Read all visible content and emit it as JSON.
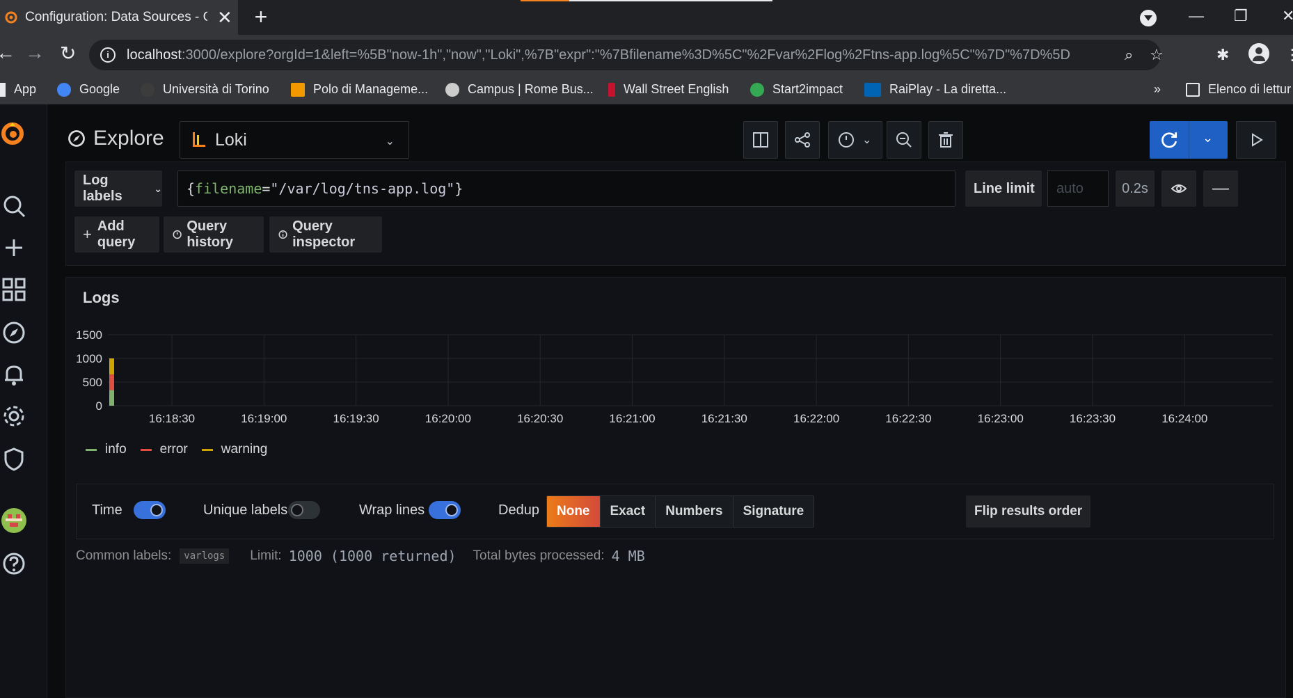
{
  "browser": {
    "tab_title": "Configuration: Data Sources - Gr",
    "tab_close": "✕",
    "new_tab": "+",
    "url_host": "localhost",
    "url_rest": ":3000/explore?orgId=1&left=%5B\"now-1h\",\"now\",\"Loki\",%7B\"expr\":\"%7Bfilename%3D%5C\"%2Fvar%2Flog%2Ftns-app.log%5C\"%7D\"%7D%5D",
    "bookmarks": [
      {
        "label": "App",
        "color": "#e8eaed"
      },
      {
        "label": "Google",
        "color": "#4285f4"
      },
      {
        "label": "Università di Torino",
        "color": "#3c3c3c"
      },
      {
        "label": "Polo di Manageme...",
        "color": "#f29900"
      },
      {
        "label": "Campus | Rome Bus...",
        "color": "#cccccc"
      },
      {
        "label": "Wall Street English",
        "color": "#c4122f"
      },
      {
        "label": "Start2impact",
        "color": "#34a853"
      },
      {
        "label": "RaiPlay - La diretta...",
        "color": "#0064b4"
      }
    ],
    "bookmarks_more": "»",
    "reading_list": "Elenco di lettur"
  },
  "explore": {
    "title": "Explore",
    "datasource": "Loki",
    "query_type": "Log labels",
    "query_parts": {
      "open": "{",
      "key": "filename",
      "eq": "=",
      "value": "\"/var/log/tns-app.log\"",
      "close": "}"
    },
    "line_limit_label": "Line limit",
    "line_limit_placeholder": "auto",
    "query_time": "0.2s",
    "add_query": "Add query",
    "query_history": "Query history",
    "query_inspector": "Query inspector"
  },
  "logs": {
    "title": "Logs",
    "options": {
      "time": {
        "label": "Time",
        "on": true
      },
      "unique_labels": {
        "label": "Unique labels",
        "on": false
      },
      "wrap_lines": {
        "label": "Wrap lines",
        "on": true
      }
    },
    "dedup_label": "Dedup",
    "dedup_options": [
      "None",
      "Exact",
      "Numbers",
      "Signature"
    ],
    "dedup_selected": "None",
    "flip_order": "Flip results order",
    "common_labels_label": "Common labels:",
    "common_label_value": "varlogs",
    "limit_label": "Limit:",
    "limit_value": "1000 (1000 returned)",
    "bytes_label": "Total bytes processed:",
    "bytes_value": "4 MB"
  },
  "chart_data": {
    "type": "bar",
    "title": "",
    "y_ticks": [
      "1500",
      "1000",
      "500",
      "0"
    ],
    "ylim": [
      0,
      1500
    ],
    "x_ticks": [
      "16:18:30",
      "16:19:00",
      "16:19:30",
      "16:20:00",
      "16:20:30",
      "16:21:00",
      "16:21:30",
      "16:22:00",
      "16:22:30",
      "16:23:00",
      "16:23:30",
      "16:24:00"
    ],
    "grid": true,
    "legend_position": "bottom-left",
    "series": [
      {
        "name": "info",
        "color": "#7eb26d",
        "values": [
          {
            "x": "16:18:05",
            "y": 330
          }
        ]
      },
      {
        "name": "error",
        "color": "#e24d42",
        "values": [
          {
            "x": "16:18:05",
            "y": 330
          }
        ]
      },
      {
        "name": "warning",
        "color": "#cca300",
        "values": [
          {
            "x": "16:18:05",
            "y": 340
          }
        ]
      }
    ],
    "stacked": true
  },
  "colors": {
    "accent_blue": "#1f60c4",
    "dedup_active": "#eb7b18",
    "switch_on": "#3871dc",
    "switch_off": "#2c3235"
  }
}
